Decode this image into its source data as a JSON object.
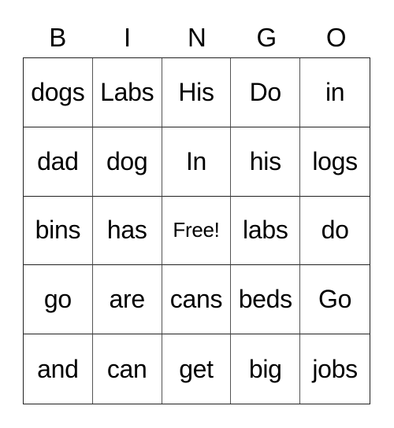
{
  "card": {
    "header": [
      "B",
      "I",
      "N",
      "G",
      "O"
    ],
    "rows": [
      [
        "dogs",
        "Labs",
        "His",
        "Do",
        "in"
      ],
      [
        "dad",
        "dog",
        "In",
        "his",
        "logs"
      ],
      [
        "bins",
        "has",
        "Free!",
        "labs",
        "do"
      ],
      [
        "go",
        "are",
        "cans",
        "beds",
        "Go"
      ],
      [
        "and",
        "can",
        "get",
        "big",
        "jobs"
      ]
    ],
    "free_space": {
      "row": 2,
      "col": 2
    }
  }
}
